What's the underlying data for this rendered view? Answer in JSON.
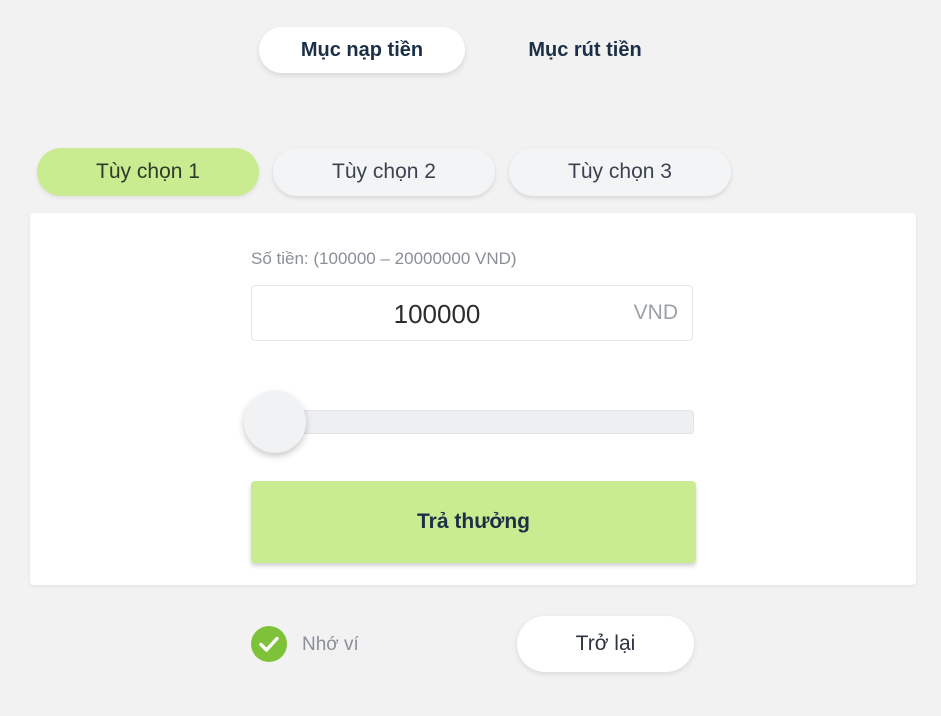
{
  "top_tabs": {
    "deposit": "Mục nạp tiền",
    "withdraw": "Mục rút tiền"
  },
  "options": [
    {
      "label": "Tùy chọn 1",
      "active": true
    },
    {
      "label": "Tùy chọn 2",
      "active": false
    },
    {
      "label": "Tùy chọn 3",
      "active": false
    }
  ],
  "form": {
    "amount_label": "Số tiền: (100000 – 20000000 VND)",
    "amount_value": "100000",
    "amount_unit": "VND",
    "slider_value": 100000,
    "slider_min": 100000,
    "slider_max": 20000000,
    "submit_label": "Trả thưởng"
  },
  "footer": {
    "remember_label": "Nhớ ví",
    "remember_checked": true,
    "back_label": "Trở lại"
  },
  "colors": {
    "accent_green": "#c9ec91",
    "check_green": "#7ec23a",
    "text_dark": "#1b3047"
  },
  "icons": {
    "check": "check-icon"
  }
}
